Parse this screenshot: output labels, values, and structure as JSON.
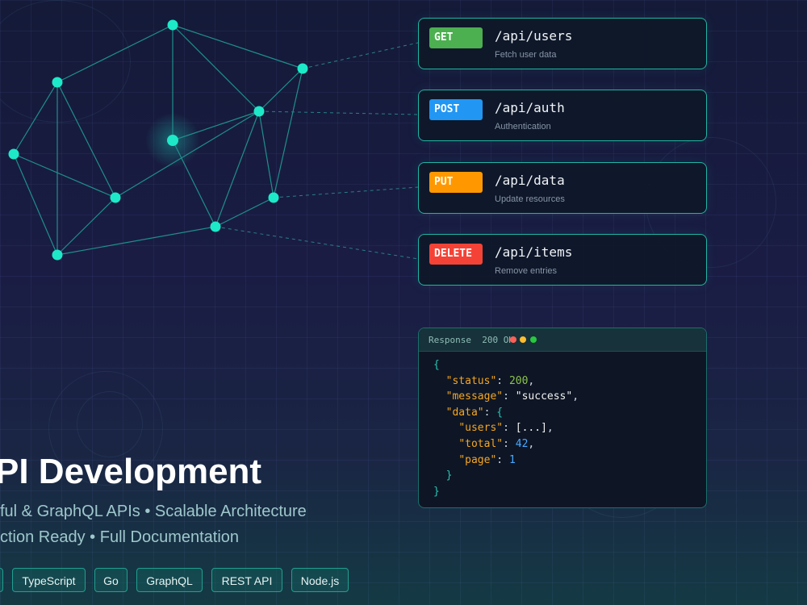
{
  "endpoints": [
    {
      "method": "GET",
      "path": "/api/users",
      "description": "Fetch user data",
      "color": "#4caf50"
    },
    {
      "method": "POST",
      "path": "/api/auth",
      "description": "Authentication",
      "color": "#2196f3"
    },
    {
      "method": "PUT",
      "path": "/api/data",
      "description": "Update resources",
      "color": "#ff9800"
    },
    {
      "method": "DELETE",
      "path": "/api/items",
      "description": "Remove entries",
      "color": "#f44336"
    }
  ],
  "response": {
    "label": "Response",
    "status_code": "200",
    "status_text": "OK",
    "window_dots": [
      "#ff5f56",
      "#ffbd2e",
      "#27c93f"
    ],
    "json": {
      "status_key": "\"status\"",
      "status_value": "200",
      "message_key": "\"message\"",
      "message_value": "\"success\"",
      "data_key": "\"data\"",
      "users_key": "\"users\"",
      "users_value": "[...]",
      "total_key": "\"total\"",
      "total_value": "42",
      "page_key": "\"page\"",
      "page_value": "1"
    }
  },
  "hero": {
    "title": "PI Development",
    "line1": "ful & GraphQL APIs  •  Scalable Architecture",
    "line2": "ction Ready  •  Full Documentation"
  },
  "tech_tags": [
    "",
    "TypeScript",
    "Go",
    "GraphQL",
    "REST API",
    "Node.js"
  ],
  "colors": {
    "node": "#1de9c8",
    "edge": "#1f8f8a",
    "card_border": "#1fb5a3"
  }
}
